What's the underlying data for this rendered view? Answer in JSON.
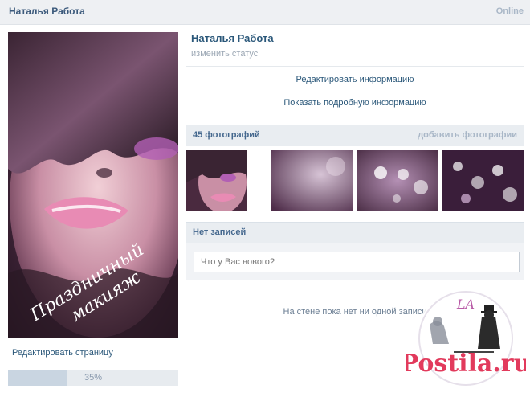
{
  "header": {
    "name": "Наталья Работа",
    "status": "Online"
  },
  "avatar": {
    "caption_line1": "Праздничный",
    "caption_line2": "макияж"
  },
  "sidebar": {
    "edit_page_label": "Редактировать страницу",
    "progress_text": "35%",
    "progress_value": 0.35
  },
  "profile": {
    "name": "Наталья Работа",
    "status_link": "изменить статус",
    "edit_info_link": "Редактировать информацию",
    "details_link": "Показать подробную информацию"
  },
  "photos": {
    "count_label": "45 фотографий",
    "add_label": "добавить фотографии",
    "thumbnails": [
      "photo-1",
      "photo-2",
      "photo-3",
      "photo-4"
    ]
  },
  "wall": {
    "header": "Нет записей",
    "placeholder": "Что у Вас нового?",
    "empty_text": "На стене пока нет ни одной записи"
  },
  "watermark": {
    "site": "Postila.ru",
    "monogram": "LA"
  },
  "colors": {
    "link": "#2b587a",
    "header_bg": "#eef0f3",
    "bar_bg": "#e9edf1",
    "muted": "#a9b7c7"
  }
}
